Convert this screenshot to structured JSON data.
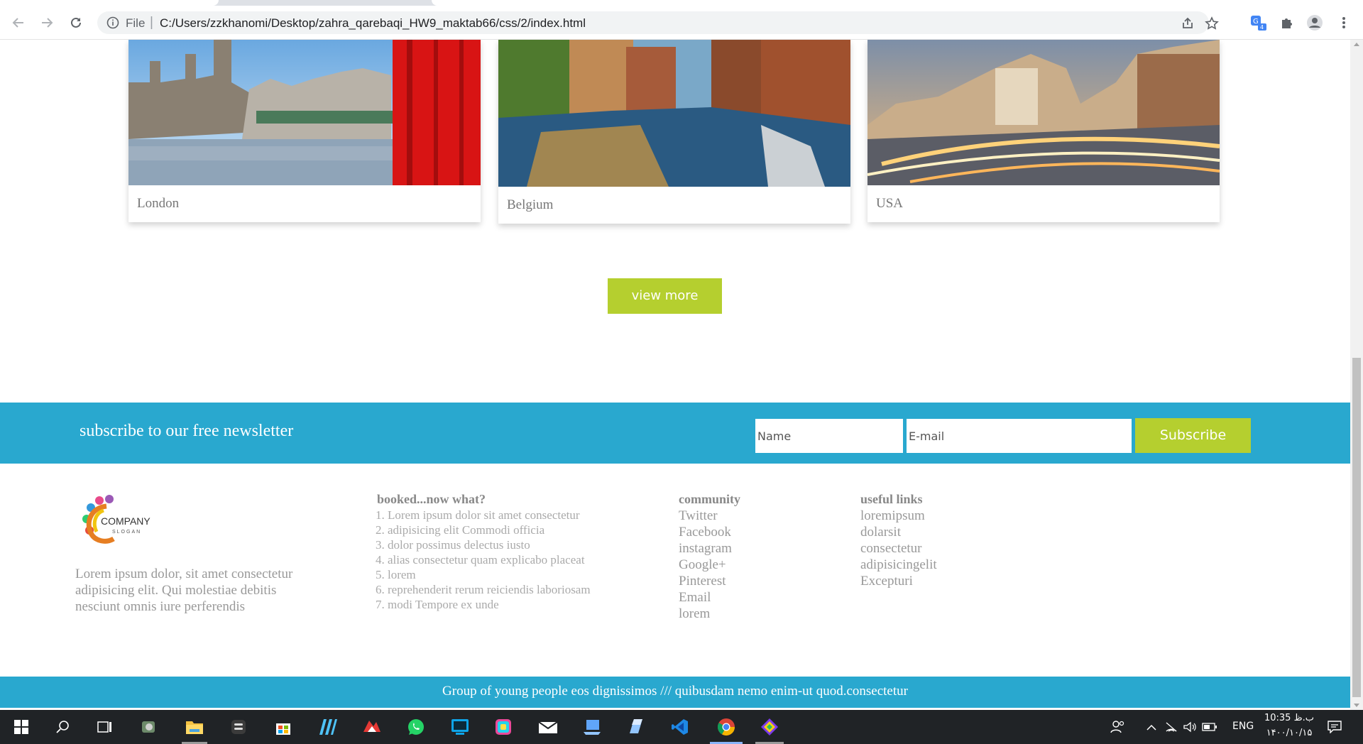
{
  "browser": {
    "address_prefix": "File",
    "url": "C:/Users/zzkhanomi/Desktop/zahra_qarebaqi_HW9_maktab66/css/2/index.html",
    "extension_badge": "4"
  },
  "destinations": [
    {
      "name": "London",
      "image": "london-photo"
    },
    {
      "name": "Belgium",
      "image": "belgium-photo"
    },
    {
      "name": "USA",
      "image": "usa-photo"
    }
  ],
  "view_more_label": "view more",
  "newsletter": {
    "title": "subscribe to our free newsletter",
    "name_placeholder": "Name",
    "email_placeholder": "E-mail",
    "button_label": "Subscribe"
  },
  "footer": {
    "logo": {
      "line1": "COMPANY",
      "line2": "SLOGAN"
    },
    "about": "Lorem ipsum dolor, sit amet consectetur adipisicing elit. Qui molestiae debitis nesciunt omnis iure perferendis",
    "booked": {
      "title": "booked...now what?",
      "items": [
        "Lorem ipsum dolor sit amet consectetur",
        "adipisicing elit Commodi officia",
        "dolor possimus delectus iusto",
        "alias consectetur quam explicabo placeat",
        "lorem",
        "reprehenderit rerum reiciendis laboriosam",
        "modi Tempore ex unde"
      ]
    },
    "community": {
      "title": "community",
      "items": [
        "Twitter",
        "Facebook",
        "instagram",
        "Google+",
        "Pinterest",
        "Email",
        "lorem"
      ]
    },
    "useful": {
      "title": "useful links",
      "items": [
        "loremipsum",
        "dolarsit",
        "consectetur",
        "adipisicingelit",
        "Excepturi"
      ]
    },
    "bottom_text": "Group of young people eos dignissimos /// quibusdam nemo enim-ut quod.consectetur"
  },
  "colors": {
    "accent_green": "#b5cf2f",
    "accent_blue": "#29a8cf",
    "taskbar": "#202326"
  },
  "taskbar": {
    "language": "ENG",
    "time": "10:35 ب.ظ",
    "date": "۱۴۰۰/۱۰/۱۵"
  }
}
